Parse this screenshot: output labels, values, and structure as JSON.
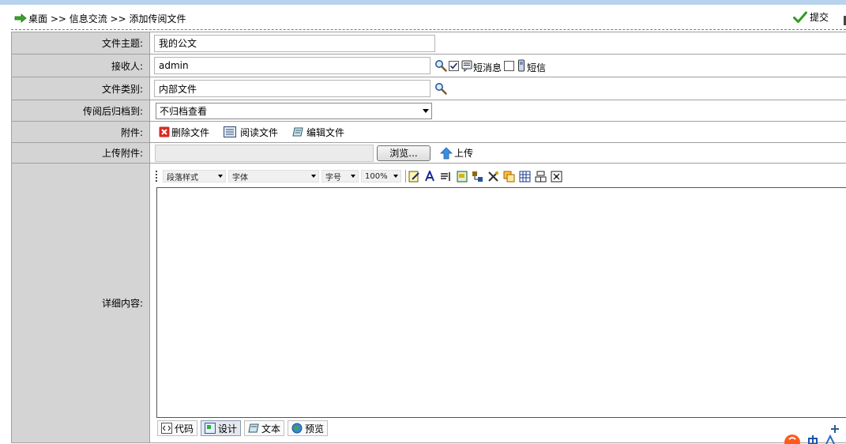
{
  "breadcrumb": {
    "text": "桌面 >> 信息交流 >> 添加传阅文件"
  },
  "toolbar": {
    "submit_label": "提交"
  },
  "form": {
    "subject": {
      "label": "文件主题:",
      "value": "我的公文"
    },
    "recipient": {
      "label": "接收人:",
      "value": "admin",
      "sms_label": "短消息",
      "sms_checked": true,
      "text_label": "短信",
      "text_checked": false
    },
    "category": {
      "label": "文件类别:",
      "value": "内部文件"
    },
    "archive": {
      "label": "传阅后归档到:",
      "selected": "不归档查看"
    },
    "attachment": {
      "label": "附件:",
      "delete": "删除文件",
      "read": "阅读文件",
      "edit": "编辑文件"
    },
    "upload": {
      "label": "上传附件:",
      "browse": "浏览...",
      "upload": "上传"
    },
    "content": {
      "label": "详细内容:"
    }
  },
  "editor": {
    "paragraph_style": "段落样式",
    "font": "字体",
    "font_size": "字号",
    "zoom": "100%",
    "modes": [
      "代码",
      "设计",
      "文本",
      "预览"
    ],
    "active_mode": "设计"
  },
  "colors": {
    "topbar": "#b7d3ee",
    "label_bg": "#d4d4d4",
    "accent_green": "#2f9b1f"
  }
}
